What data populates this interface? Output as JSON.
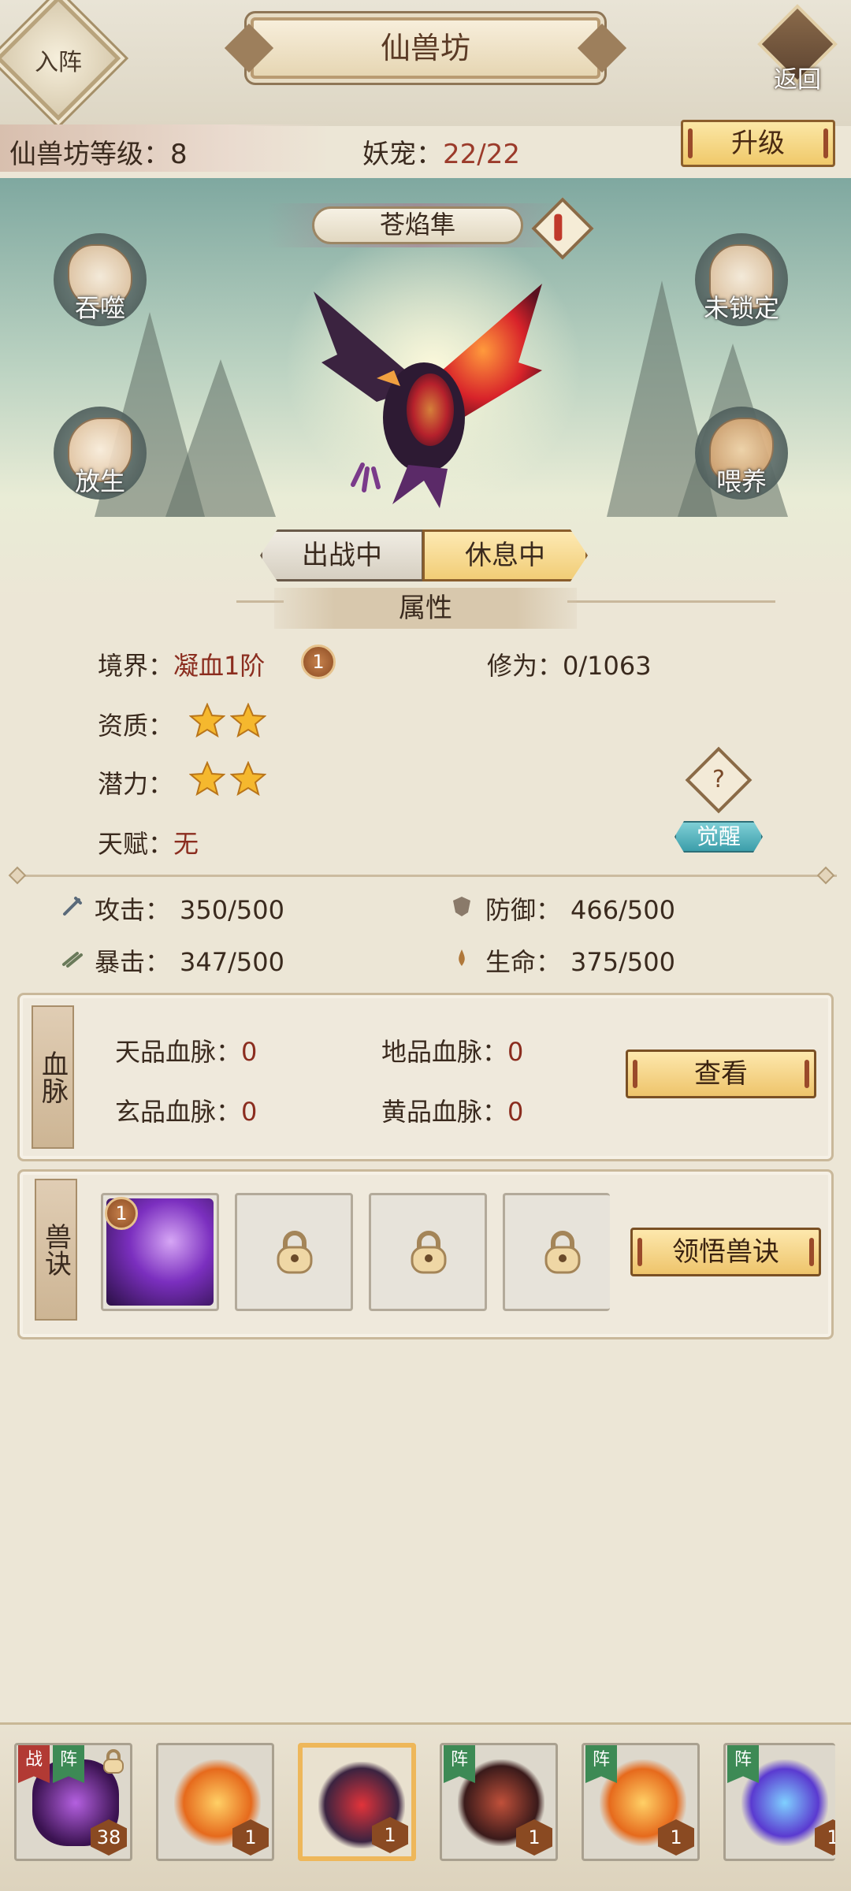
{
  "header": {
    "formation_label": "入阵",
    "title": "仙兽坊",
    "back_label": "返回"
  },
  "status": {
    "workshop_level_label": "仙兽坊等级：",
    "workshop_level": "8",
    "pet_label": "妖宠：",
    "pet_count": "22/22",
    "upgrade_label": "升级"
  },
  "pet": {
    "name": "苍焰隼",
    "actions": {
      "devour": "吞噬",
      "lock": "未锁定",
      "release": "放生",
      "feed": "喂养"
    },
    "toggle": {
      "battle": "出战中",
      "resting": "休息中",
      "active": "resting"
    }
  },
  "attributes": {
    "section_title": "属性",
    "realm_label": "境界：",
    "realm_value": "凝血1阶",
    "realm_badge": "1",
    "cultivation_label": "修为：",
    "cultivation_value": "0/1063",
    "aptitude_label": "资质：",
    "aptitude_stars": 2,
    "potential_label": "潜力：",
    "potential_stars": 2,
    "talent_label": "天赋：",
    "talent_value": "无",
    "help_icon": "?",
    "awaken_label": "觉醒",
    "stats": {
      "attack_label": "攻击：",
      "attack_value": "350/500",
      "defense_label": "防御：",
      "defense_value": "466/500",
      "crit_label": "暴击：",
      "crit_value": "347/500",
      "hp_label": "生命：",
      "hp_value": "375/500"
    }
  },
  "bloodline": {
    "tag": "血脉",
    "heaven_label": "天品血脉：",
    "heaven_value": "0",
    "earth_label": "地品血脉：",
    "earth_value": "0",
    "mystic_label": "玄品血脉：",
    "mystic_value": "0",
    "yellow_label": "黄品血脉：",
    "yellow_value": "0",
    "view_label": "查看"
  },
  "skills": {
    "tag": "兽诀",
    "first_skill_level": "1",
    "comprehend_label": "领悟兽诀"
  },
  "roster": [
    {
      "level": "38",
      "flags": [
        "战",
        "阵"
      ],
      "locked": true
    },
    {
      "level": "1",
      "flags": []
    },
    {
      "level": "1",
      "flags": [],
      "selected": true
    },
    {
      "level": "1",
      "flags": [
        "阵"
      ]
    },
    {
      "level": "1",
      "flags": [
        "阵"
      ]
    },
    {
      "level": "1",
      "flags": [
        "阵"
      ]
    }
  ],
  "colors": {
    "value_red": "#8b2d1f",
    "gold_button": "#f0c96a",
    "awaken_teal": "#3c9eaa"
  }
}
